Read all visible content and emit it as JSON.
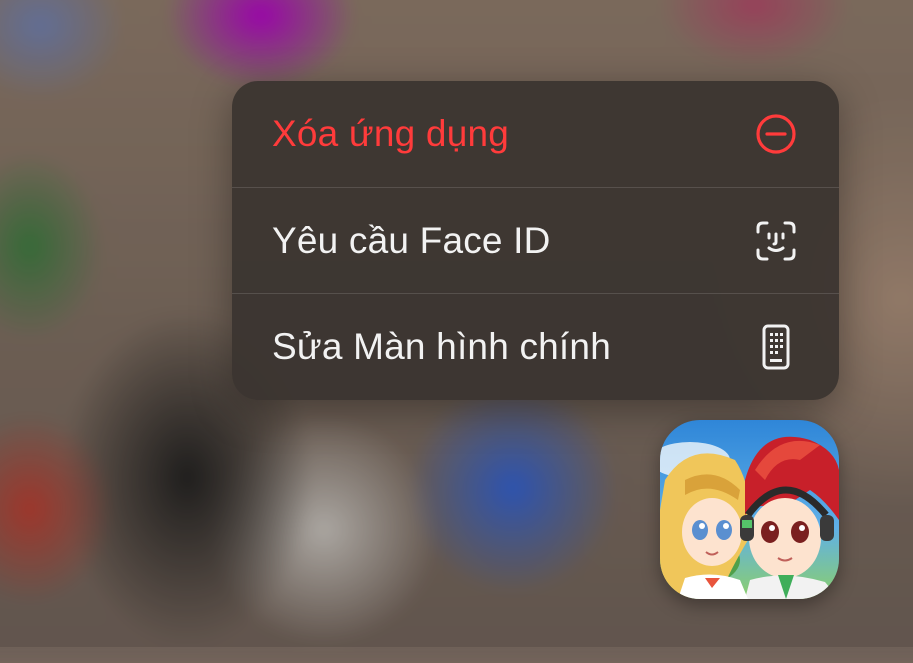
{
  "context_menu": {
    "items": [
      {
        "label": "Xóa ứng dụng",
        "icon": "minus-circle-icon",
        "destructive": true
      },
      {
        "label": "Yêu cầu Face ID",
        "icon": "face-id-icon",
        "destructive": false
      },
      {
        "label": "Sửa Màn hình chính",
        "icon": "phone-grid-icon",
        "destructive": false
      }
    ]
  },
  "colors": {
    "destructive": "#ff3b3b",
    "menu_background": "#3a3430",
    "text": "#f2f2f2"
  },
  "app_icon": {
    "icon": "anime-game-app-icon"
  }
}
